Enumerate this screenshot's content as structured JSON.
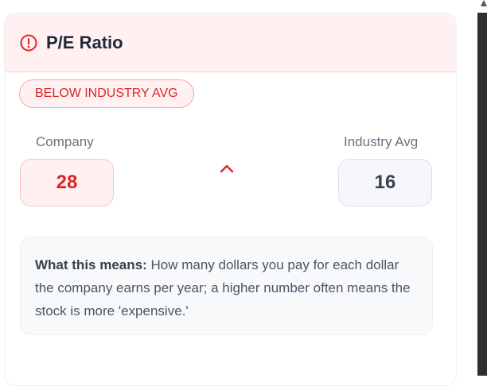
{
  "card": {
    "title": "P/E Ratio",
    "icon": "info-circle-icon",
    "badge": "BELOW INDUSTRY AVG"
  },
  "comparison": {
    "company_label": "Company",
    "company_value": "28",
    "industry_label": "Industry Avg",
    "industry_value": "16",
    "indicator_icon": "chevron-up-icon"
  },
  "explanation": {
    "lead": "What this means:",
    "body": " How many dollars you pay for each dollar the company earns per year; a higher number often means the stock is more 'expensive.'"
  },
  "colors": {
    "accent_red": "#dc2626",
    "header_bg": "#fff1f1",
    "neutral_box": "#f5f7fa"
  }
}
